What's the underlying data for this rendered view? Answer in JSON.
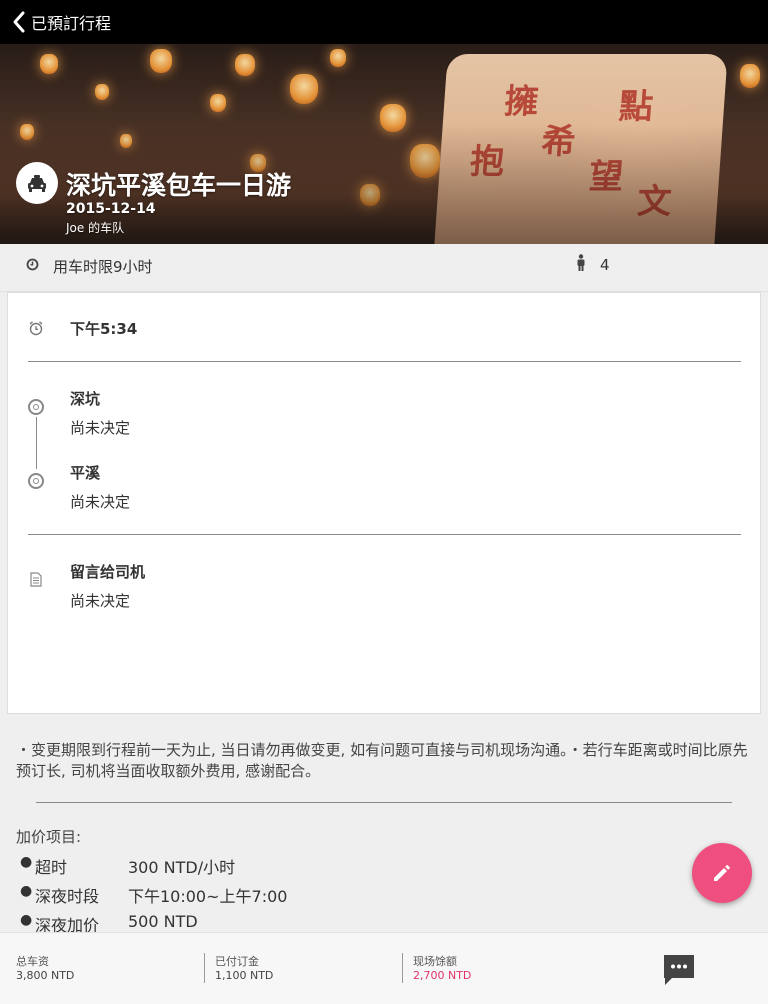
{
  "topbar": {
    "back_label": "已預訂行程"
  },
  "hero": {
    "title": "深坑平溪包车一日游",
    "date": "2015-12-14",
    "fleet": "Joe 的车队"
  },
  "info": {
    "duration": "用车时限9小时",
    "passengers": "4"
  },
  "schedule": {
    "pickup_time": "下午5:34",
    "stops": [
      {
        "name": "深坑",
        "status": "尚未决定"
      },
      {
        "name": "平溪",
        "status": "尚未决定"
      }
    ],
    "message_title": "留言给司机",
    "message_value": "尚未决定"
  },
  "notice": "・变更期限到行程前一天为止, 当日请勿再做变更, 如有问题可直接与司机现场沟通。・若行车距离或时间比原先预订长, 司机将当面收取额外费用, 感谢配合。",
  "surcharges": {
    "title": "加价项目:",
    "items": [
      {
        "name": "超时",
        "value": "300 NTD/小时"
      },
      {
        "name": "深夜时段",
        "value": "下午10:00~上午7:00"
      },
      {
        "name": "深夜加价",
        "value": "500 NTD"
      }
    ]
  },
  "footer": {
    "total_label": "总车资",
    "total_value": "3,800 NTD",
    "paid_label": "已付订金",
    "paid_value": "1,100 NTD",
    "balance_label": "现场馀额",
    "balance_value": "2,700 NTD"
  },
  "colors": {
    "accent": "#ee4f7e",
    "balance": "#e0336e",
    "topbar": "#000000"
  },
  "icons": [
    "back-chevron-icon",
    "car-icon",
    "clock-icon",
    "person-icon",
    "alarm-icon",
    "location-ring-icon",
    "note-icon",
    "edit-pencil-icon",
    "chat-icon"
  ]
}
